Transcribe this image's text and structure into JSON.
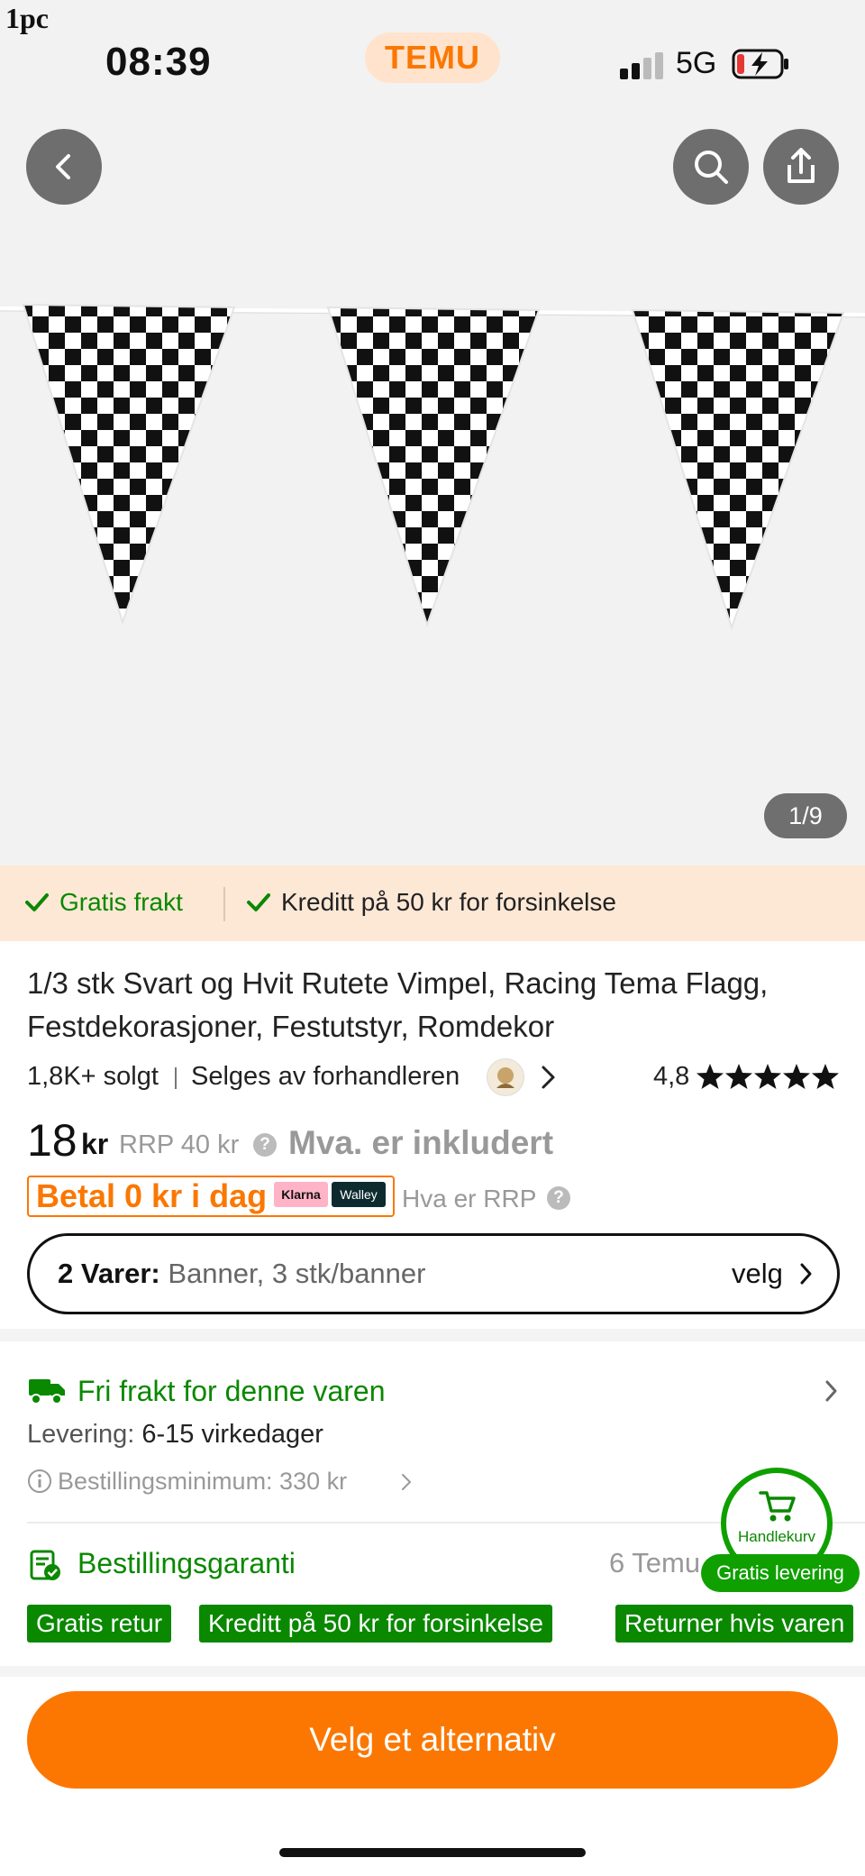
{
  "status_bar": {
    "watermark": "1pc",
    "time": "08:39",
    "brand": "TEMU",
    "network": "5G",
    "icons": [
      "signal-icon",
      "battery-charging-icon"
    ]
  },
  "hero": {
    "icons": [
      "back-icon",
      "search-icon",
      "share-icon"
    ],
    "image_counter": "1/9"
  },
  "benefits": {
    "free_shipping": "Gratis frakt",
    "delay_credit": "Kreditt på 50 kr for forsinkelse"
  },
  "product": {
    "title_line1": "1/3 stk Svart og Hvit Rutete Vimpel, Racing Tema Flagg,",
    "title_line2": "Festdekorasjoner, Festutstyr, Romdekor",
    "sold": "1,8K+ solgt",
    "seller": "Selges av forhandleren",
    "rating": "4,8",
    "rating_value": 4.8,
    "price": "18",
    "currency": "kr",
    "rrp": "RRP 40 kr",
    "vat_note": "Mva. er inkludert",
    "pay_today": "Betal 0 kr i dag",
    "klarna": "Klarna",
    "walley": "Walley",
    "rrp_question": "Hva er RRP"
  },
  "variant": {
    "label": "2 Varer:",
    "value": "Banner, 3 stk/banner",
    "action": "velg"
  },
  "shipping": {
    "title": "Fri frakt for denne varen",
    "delivery_label": "Levering:",
    "delivery_value": "6-15 virkedager",
    "min_order": "Bestillingsminimum: 330 kr"
  },
  "guarantee": {
    "title": "Bestillingsgaranti",
    "right_text": "6 Temu",
    "tags": [
      "Gratis retur",
      "Kreditt på 50 kr for forsinkelse",
      "Returner hvis varen"
    ]
  },
  "cart": {
    "label": "Handlekurv",
    "free_delivery": "Gratis levering"
  },
  "cta": {
    "label": "Velg et alternativ"
  },
  "colors": {
    "accent": "#fb7701",
    "green": "#0a8800",
    "benefit_bg": "#fde8d6"
  }
}
